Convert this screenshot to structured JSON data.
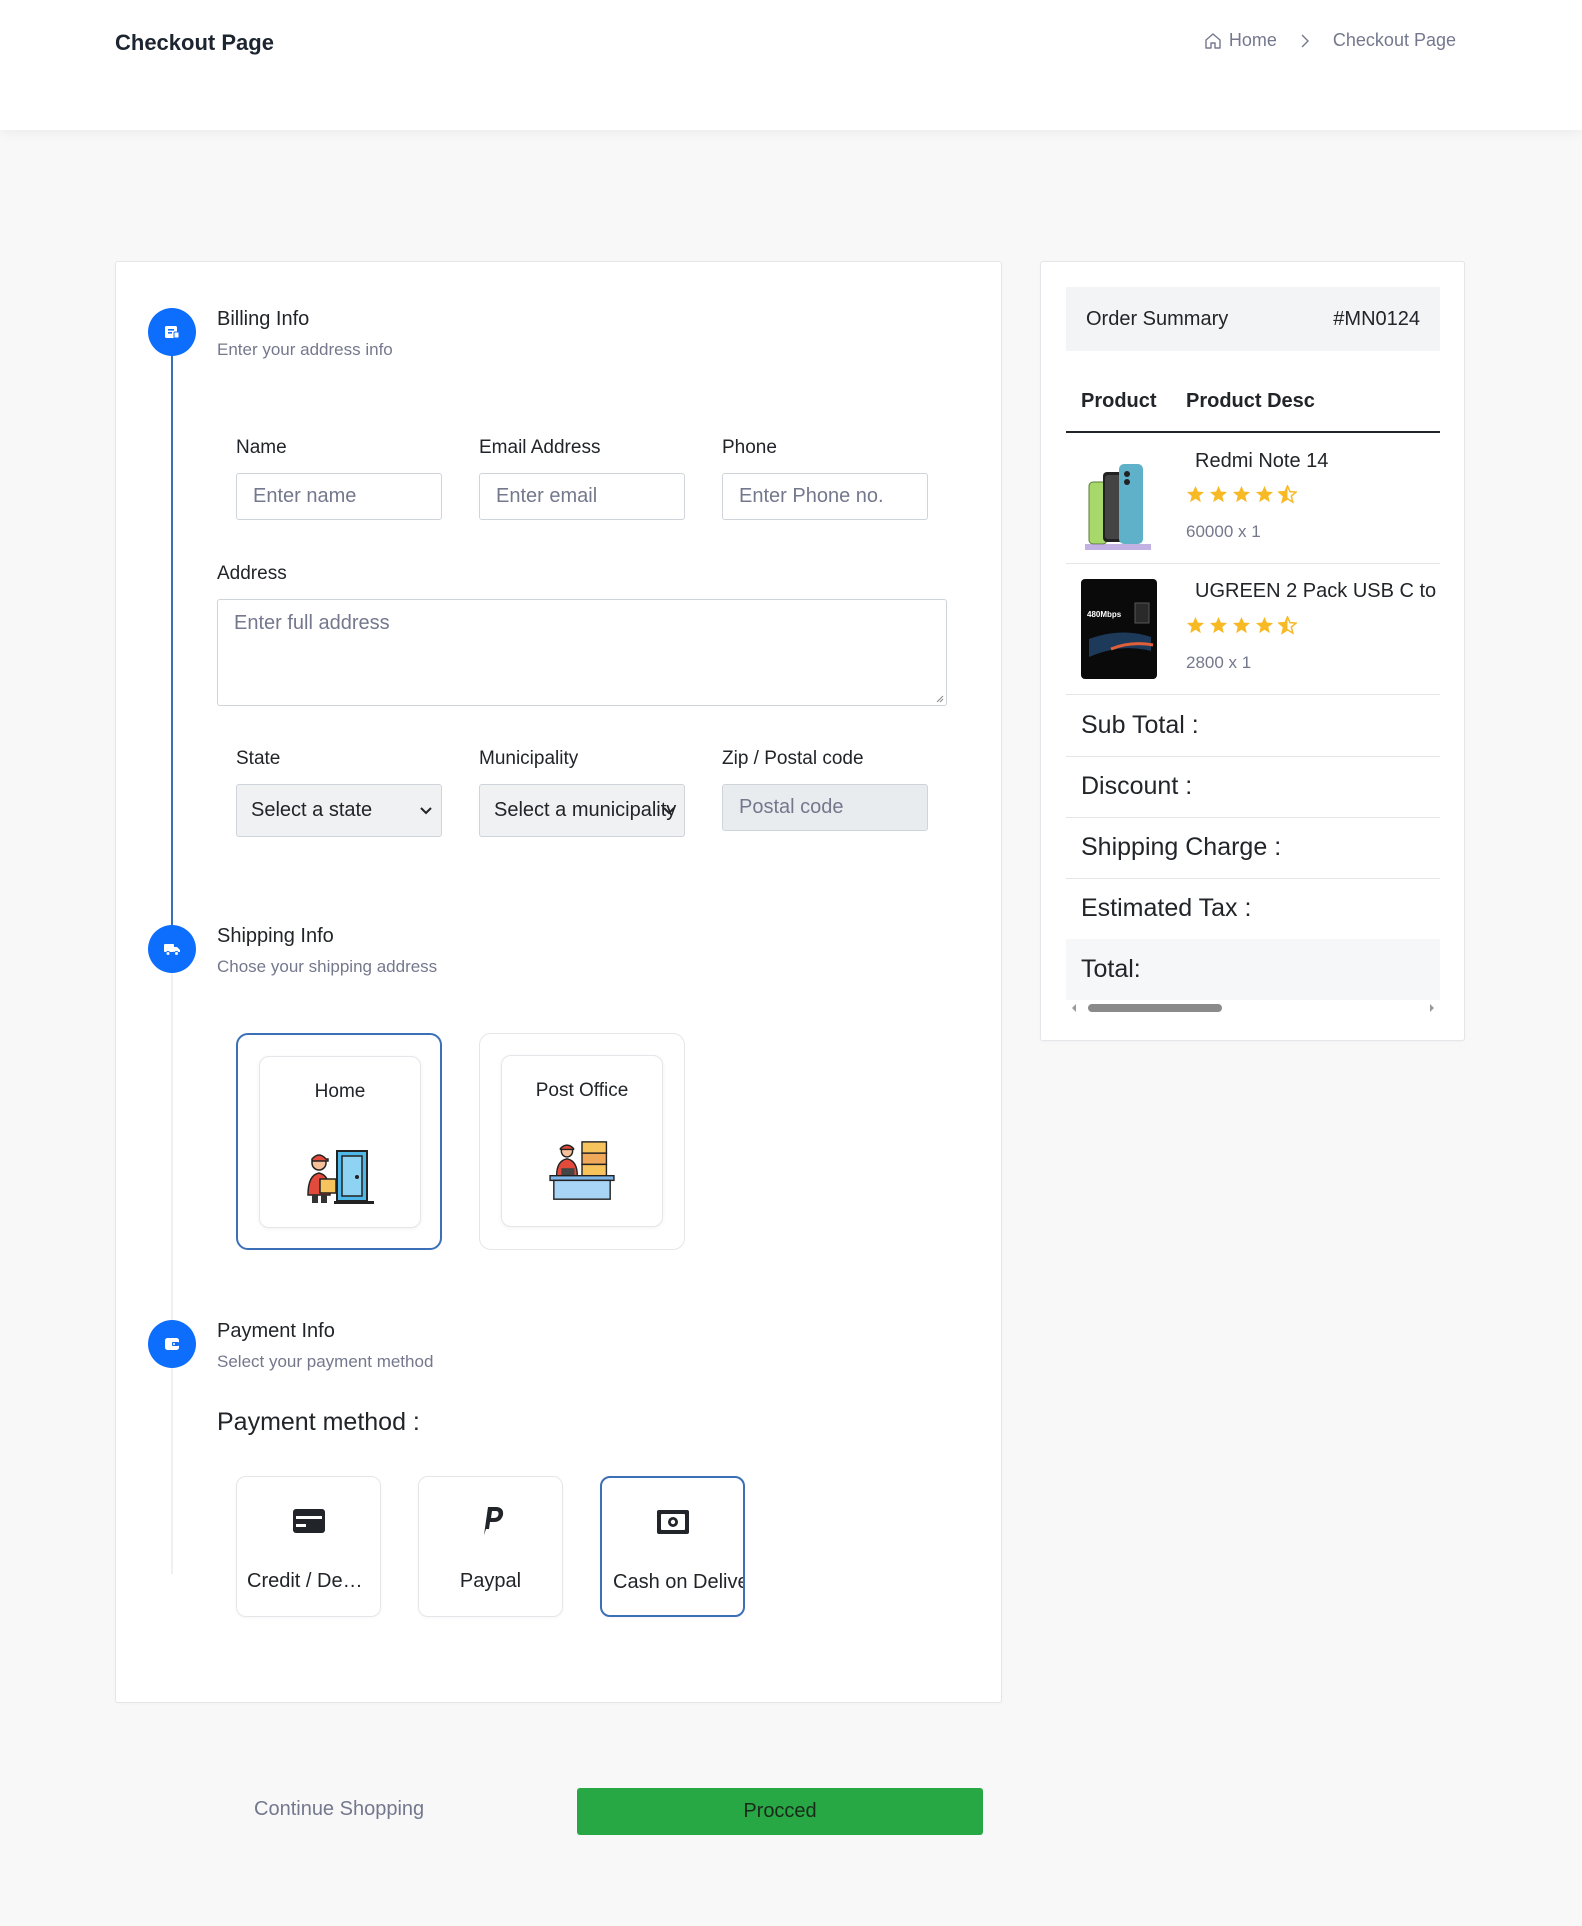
{
  "header": {
    "title": "Checkout Page",
    "breadcrumb": {
      "home": "Home",
      "current": "Checkout Page"
    }
  },
  "billing": {
    "title": "Billing Info",
    "subtitle": "Enter your address info",
    "name_label": "Name",
    "name_placeholder": "Enter name",
    "email_label": "Email Address",
    "email_placeholder": "Enter email",
    "phone_label": "Phone",
    "phone_placeholder": "Enter Phone no.",
    "address_label": "Address",
    "address_placeholder": "Enter full address",
    "state_label": "State",
    "state_value": "Select a state",
    "municipality_label": "Municipality",
    "municipality_value": "Select a municipality",
    "zip_label": "Zip / Postal code",
    "zip_placeholder": "Postal code"
  },
  "shipping": {
    "title": "Shipping Info",
    "subtitle": "Chose your shipping address",
    "options": [
      {
        "label": "Home",
        "selected": true
      },
      {
        "label": "Post Office",
        "selected": false
      }
    ]
  },
  "payment": {
    "title": "Payment Info",
    "subtitle": "Select your payment method",
    "heading": "Payment method :",
    "options": [
      {
        "label": "Credit / Debit Card",
        "icon": "credit-card-icon",
        "selected": false
      },
      {
        "label": "Paypal",
        "icon": "paypal-icon",
        "selected": false
      },
      {
        "label": "Cash on Delivery",
        "icon": "cash-icon",
        "selected": true
      }
    ]
  },
  "summary": {
    "title": "Order Summary",
    "order_id": "#MN0124",
    "columns": [
      "Product",
      "Product Desc"
    ],
    "products": [
      {
        "name": "Redmi Note 14",
        "rating": 4.5,
        "qty_text": "60000 x 1",
        "image": "phone-image"
      },
      {
        "name": "UGREEN 2 Pack USB C to",
        "rating": 4.5,
        "qty_text": "2800 x 1",
        "image": "cable-image",
        "image_text": "480Mbps"
      }
    ],
    "totals": [
      "Sub Total :",
      "Discount :",
      "Shipping Charge :",
      "Estimated Tax :",
      "Total:"
    ]
  },
  "actions": {
    "continue": "Continue Shopping",
    "proceed": "Procced"
  },
  "colors": {
    "accent": "#0d6efd",
    "selected_border": "#3b6fb6",
    "star": "#f7b924",
    "proceed": "#28a745"
  }
}
